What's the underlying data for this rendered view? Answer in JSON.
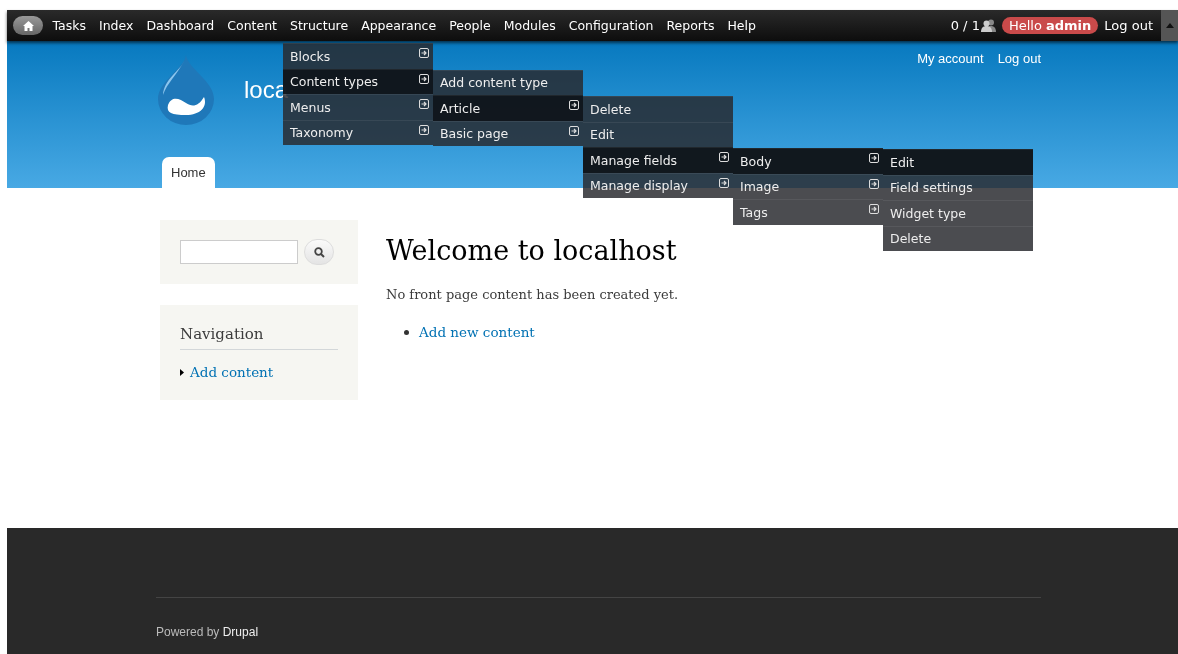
{
  "toolbar": {
    "items": [
      {
        "label": "Tasks"
      },
      {
        "label": "Index"
      },
      {
        "label": "Dashboard"
      },
      {
        "label": "Content"
      },
      {
        "label": "Structure",
        "menu": [
          {
            "label": "Blocks",
            "selected": false,
            "expandable": true
          },
          {
            "label": "Content types",
            "selected": true,
            "expandable": true,
            "children": [
              {
                "label": "Add content type",
                "selected": false,
                "expandable": false
              },
              {
                "label": "Article",
                "selected": true,
                "expandable": true,
                "children": [
                  {
                    "label": "Delete",
                    "selected": false,
                    "expandable": false
                  },
                  {
                    "label": "Edit",
                    "selected": false,
                    "expandable": false
                  },
                  {
                    "label": "Manage fields",
                    "selected": true,
                    "expandable": true,
                    "children": [
                      {
                        "label": "Body",
                        "selected": true,
                        "expandable": true,
                        "children": [
                          {
                            "label": "Edit",
                            "selected": true,
                            "expandable": false
                          },
                          {
                            "label": "Field settings",
                            "selected": false,
                            "expandable": false
                          },
                          {
                            "label": "Widget type",
                            "selected": false,
                            "expandable": false
                          },
                          {
                            "label": "Delete",
                            "selected": false,
                            "expandable": false
                          }
                        ]
                      },
                      {
                        "label": "Image",
                        "selected": false,
                        "expandable": true
                      },
                      {
                        "label": "Tags",
                        "selected": false,
                        "expandable": true
                      }
                    ]
                  },
                  {
                    "label": "Manage display",
                    "selected": false,
                    "expandable": true
                  }
                ]
              },
              {
                "label": "Basic page",
                "selected": false,
                "expandable": true
              }
            ]
          },
          {
            "label": "Menus",
            "selected": false,
            "expandable": true
          },
          {
            "label": "Taxonomy",
            "selected": false,
            "expandable": true
          }
        ]
      },
      {
        "label": "Appearance"
      },
      {
        "label": "People"
      },
      {
        "label": "Modules"
      },
      {
        "label": "Configuration"
      },
      {
        "label": "Reports"
      },
      {
        "label": "Help"
      }
    ],
    "user_count": "0 / 1",
    "greeting": "Hello **admin**",
    "logout": "Log out"
  },
  "header": {
    "site_name": "loca",
    "secondary_links": [
      "My account",
      "Log out"
    ],
    "tabs": [
      {
        "label": "Home",
        "selected": true
      }
    ]
  },
  "sidebar": {
    "navigation": {
      "title": "Navigation",
      "links": [
        "Add content"
      ]
    }
  },
  "main": {
    "title": "Welcome to localhost",
    "message": "No front page content has been created yet.",
    "links": [
      "Add new content"
    ]
  },
  "footer": {
    "text": "Powered by",
    "link": "Drupal"
  }
}
